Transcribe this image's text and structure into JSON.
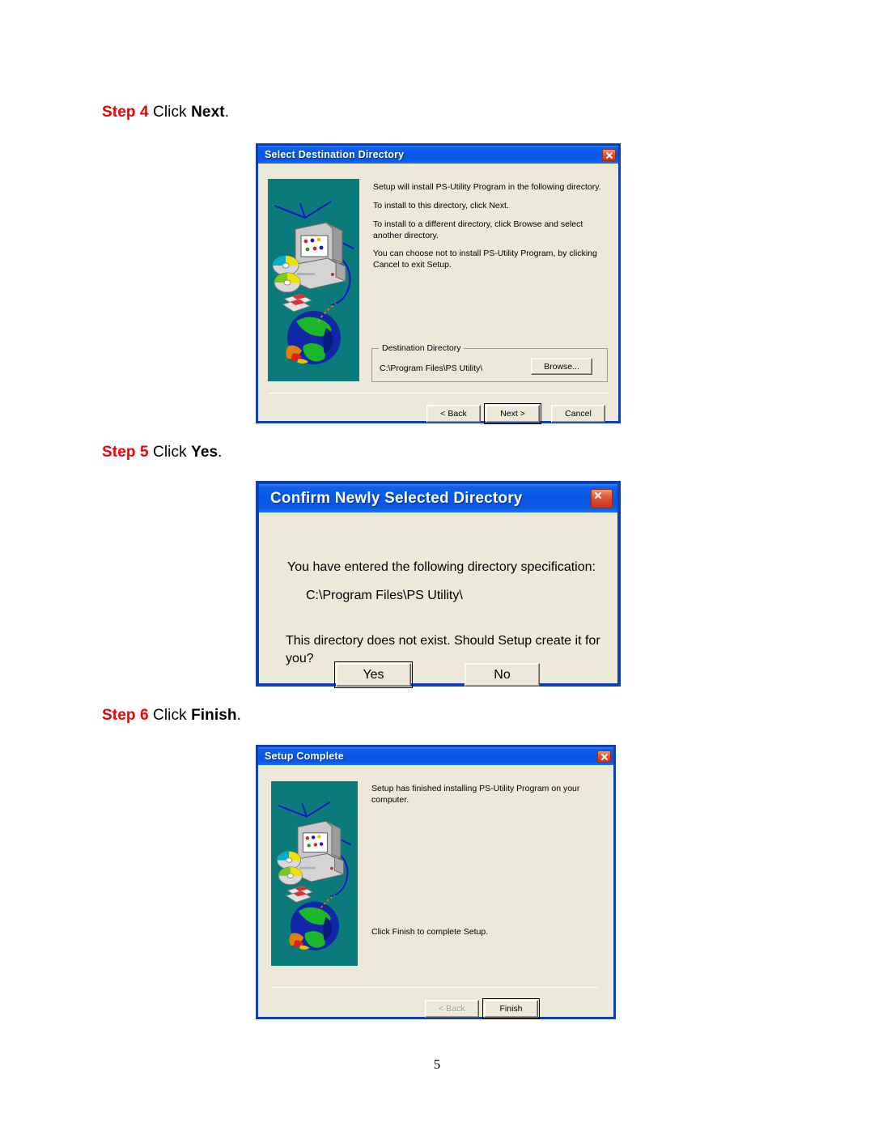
{
  "page": {
    "number": "5"
  },
  "steps": [
    {
      "label": "Step",
      "num": "4",
      "verb": "Click",
      "target": "Next",
      "period": "."
    },
    {
      "label": "Step",
      "num": "5",
      "verb": "Click",
      "target": "Yes",
      "period": "."
    },
    {
      "label": "Step",
      "num": "6",
      "verb": "Click",
      "target": "Finish",
      "period": "."
    }
  ],
  "colors": {
    "step_accent": "#ef0000",
    "title_blue": "#0a55e4",
    "dialog_face": "#ece9d8",
    "art_teal": "#0a7a7a",
    "close_red": "#c93419"
  },
  "dialog_select_destination": {
    "title": "Select Destination Directory",
    "close_icon": "close-icon",
    "art_icon": "computer-network-globe-illustration",
    "paragraphs": [
      "Setup will install PS-Utility Program in the following directory.",
      "To install to this directory, click Next.",
      "To install to a different directory, click Browse and select another directory.",
      "You can choose not to install PS-Utility Program, by clicking Cancel to exit Setup."
    ],
    "groupbox": {
      "legend": "Destination Directory",
      "path": "C:\\Program Files\\PS Utility\\",
      "browse_label": "Browse..."
    },
    "buttons": {
      "back": "< Back",
      "next": "Next >",
      "cancel": "Cancel"
    }
  },
  "dialog_confirm_directory": {
    "title": "Confirm Newly Selected Directory",
    "close_icon": "close-icon",
    "line_intro": "You have entered the following directory specification:",
    "line_path": "C:\\Program Files\\PS Utility\\",
    "line_question": "This directory does not exist.  Should Setup create it for you?",
    "buttons": {
      "yes": "Yes",
      "no": "No"
    }
  },
  "dialog_setup_complete": {
    "title": "Setup Complete",
    "close_icon": "close-icon",
    "art_icon": "computer-network-globe-illustration",
    "line_finished": "Setup has finished installing PS-Utility Program on your computer.",
    "line_click": "Click Finish to complete Setup.",
    "buttons": {
      "back": "< Back",
      "finish": "Finish"
    }
  }
}
